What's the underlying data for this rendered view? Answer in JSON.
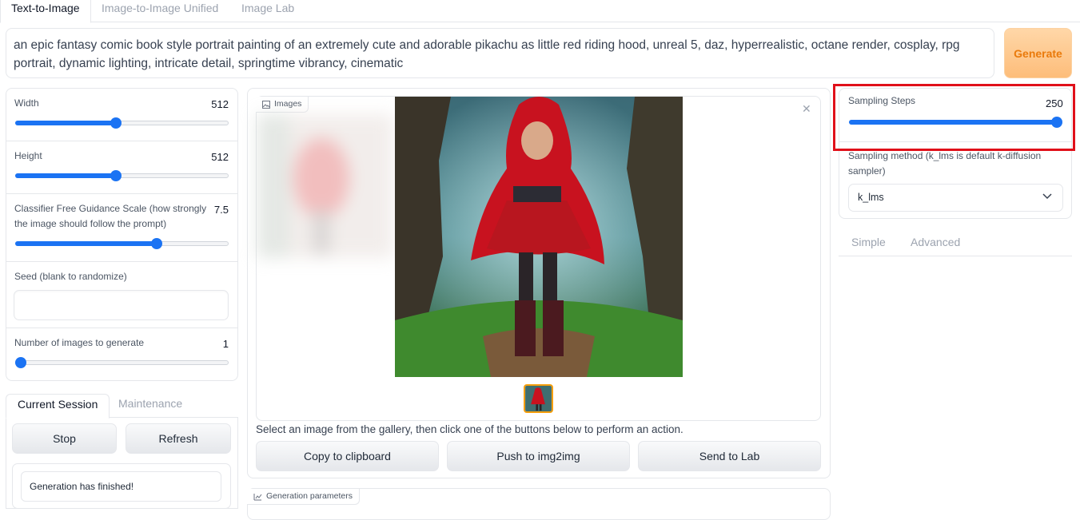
{
  "tabs": [
    "Text-to-Image",
    "Image-to-Image Unified",
    "Image Lab"
  ],
  "prompt": "an epic fantasy comic book style portrait painting of an extremely cute and adorable pikachu as little red riding hood, unreal 5, daz, hyperrealistic, octane render, cosplay, rpg portrait, dynamic lighting, intricate detail, springtime vibrancy, cinematic",
  "generate_label": "Generate",
  "left": {
    "width": {
      "label": "Width",
      "value": "512",
      "fraction": 0.47
    },
    "height": {
      "label": "Height",
      "value": "512",
      "fraction": 0.47
    },
    "cfg": {
      "label": "Classifier Free Guidance Scale (how strongly the image should follow the prompt)",
      "value": "7.5",
      "fraction": 0.67
    },
    "seed": {
      "label": "Seed (blank to randomize)",
      "value": ""
    },
    "num_images": {
      "label": "Number of images to generate",
      "value": "1",
      "fraction": 0.0
    }
  },
  "session": {
    "tabs": [
      "Current Session",
      "Maintenance"
    ],
    "stop_label": "Stop",
    "refresh_label": "Refresh",
    "status": "Generation has finished!"
  },
  "gallery": {
    "label": "Images",
    "helper": "Select an image from the gallery, then click one of the buttons below to perform an action.",
    "buttons": [
      "Copy to clipboard",
      "Push to img2img",
      "Send to Lab"
    ],
    "params_label": "Generation parameters"
  },
  "right": {
    "steps": {
      "label": "Sampling Steps",
      "value": "250",
      "fraction": 1.0
    },
    "method": {
      "label": "Sampling method (k_lms is default k-diffusion sampler)",
      "value": "k_lms"
    },
    "tabs": [
      "Simple",
      "Advanced"
    ]
  },
  "colors": {
    "accent": "#1b73f3",
    "generate_text": "#ea7a0b",
    "highlight": "#e0101a"
  }
}
